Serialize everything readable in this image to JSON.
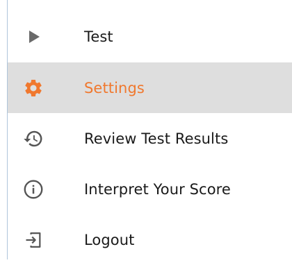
{
  "menu": {
    "items": [
      {
        "label": "Test",
        "icon": "play-icon",
        "active": false
      },
      {
        "label": "Settings",
        "icon": "gear-icon",
        "active": true
      },
      {
        "label": "Review Test Results",
        "icon": "history-icon",
        "active": false
      },
      {
        "label": "Interpret Your Score",
        "icon": "info-icon",
        "active": false
      },
      {
        "label": "Logout",
        "icon": "logout-icon",
        "active": false
      }
    ]
  },
  "colors": {
    "active_accent": "#f0782e",
    "active_background": "#dedede",
    "icon_default": "#6a6a6a",
    "text_default": "#1a1a1a",
    "panel_border": "#aec4da"
  }
}
